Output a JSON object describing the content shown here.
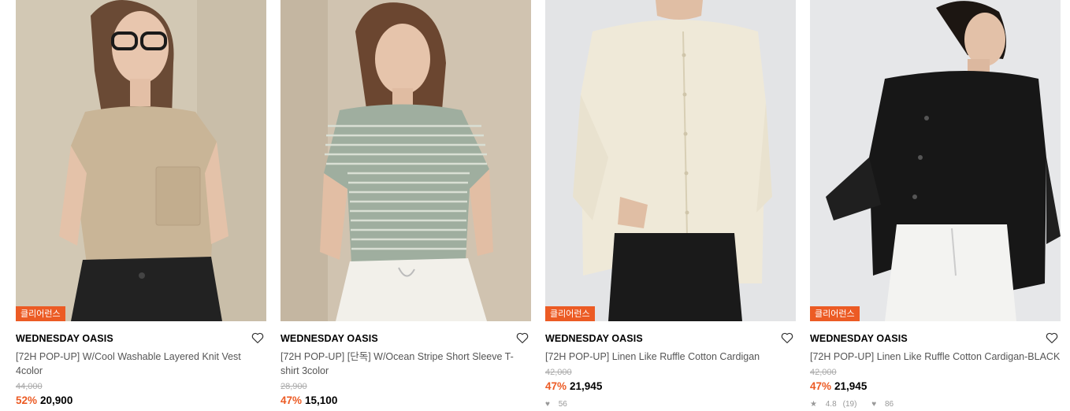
{
  "products": [
    {
      "badge": "클리어런스",
      "brand": "WEDNESDAY OASIS",
      "title": "[72H POP-UP] W/Cool Washable Layered Knit Vest 4color",
      "original_price": "44,000",
      "discount": "52%",
      "price": "20,900",
      "model": "woman-beige-knit-vest"
    },
    {
      "badge": "",
      "brand": "WEDNESDAY OASIS",
      "title": "[72H POP-UP] [단독] W/Ocean Stripe Short Sleeve T-shirt 3color",
      "original_price": "28,900",
      "discount": "47%",
      "price": "15,100",
      "model": "woman-striped-tshirt"
    },
    {
      "badge": "클리어런스",
      "brand": "WEDNESDAY OASIS",
      "title": "[72H POP-UP] Linen Like Ruffle Cotton Cardigan",
      "original_price": "42,000",
      "discount": "47%",
      "price": "21,945",
      "likes": "56",
      "model": "man-cream-cardigan"
    },
    {
      "badge": "클리어런스",
      "brand": "WEDNESDAY OASIS",
      "title": "[72H POP-UP] Linen Like Ruffle Cotton Cardigan-BLACK",
      "original_price": "42,000",
      "discount": "47%",
      "price": "21,945",
      "rating": "4.8",
      "reviews": "(19)",
      "likes": "86",
      "model": "man-black-cardigan"
    }
  ],
  "colors": {
    "accent": "#ec5b24",
    "text": "#000000",
    "muted": "#555555",
    "strike": "#aaaaaa"
  },
  "icons": {
    "wishlist": "heart-outline-icon",
    "star": "star-icon",
    "like": "heart-filled-icon"
  }
}
